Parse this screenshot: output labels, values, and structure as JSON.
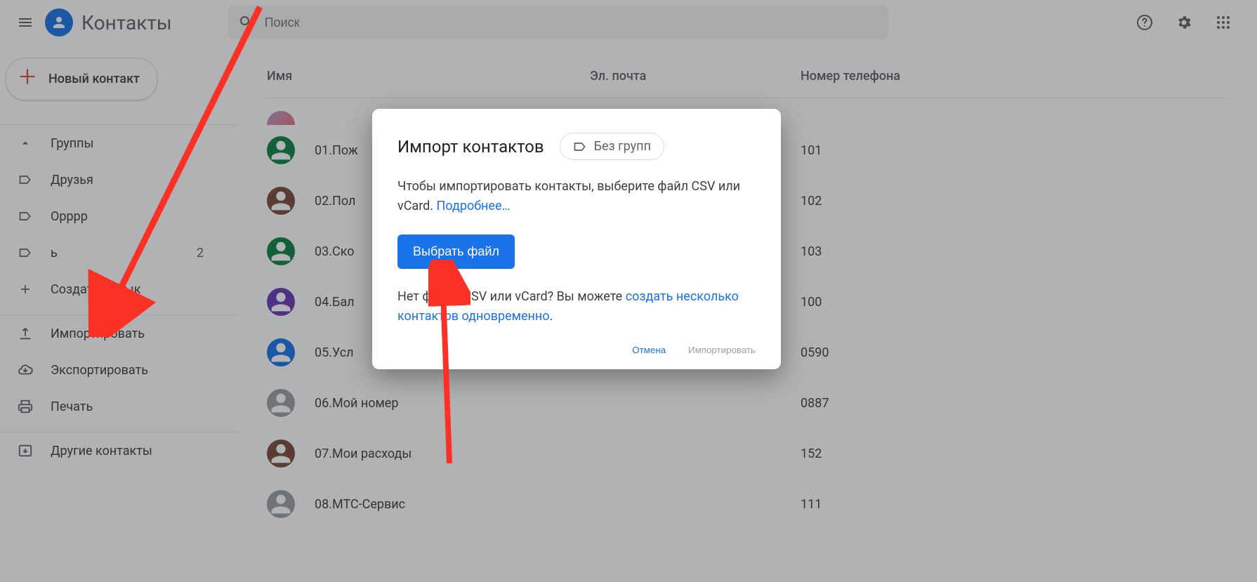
{
  "header": {
    "app_title": "Контакты",
    "search_placeholder": "Поиск"
  },
  "sidebar": {
    "new_contact_label": "Новый контакт",
    "groups_label": "Группы",
    "labels": [
      {
        "name": "Друзья"
      },
      {
        "name": "Opppp"
      },
      {
        "name": "ь",
        "count": "2"
      }
    ],
    "create_label": "Создать ярлык",
    "import_label": "Импортировать",
    "export_label": "Экспортировать",
    "print_label": "Печать",
    "other_contacts_label": "Другие контакты"
  },
  "table": {
    "col_name": "Имя",
    "col_email": "Эл. почта",
    "col_phone": "Номер телефона"
  },
  "contacts": [
    {
      "name": "01.Пож",
      "phone": "101",
      "color": "#0b8043"
    },
    {
      "name": "02.Пол",
      "phone": "102",
      "color": "#7b4b3a"
    },
    {
      "name": "03.Ско",
      "phone": "103",
      "color": "#0b8043"
    },
    {
      "name": "04.Бал",
      "phone": "100",
      "color": "#673ab7"
    },
    {
      "name": "05.Усл",
      "phone": "0590",
      "color": "#1a73e8"
    },
    {
      "name": "06.Мой номер",
      "phone": "0887",
      "color": "#9aa0a6"
    },
    {
      "name": "07.Мои расходы",
      "phone": "152",
      "color": "#7b4b3a"
    },
    {
      "name": "08.МТС-Сервис",
      "phone": "111",
      "color": "#9aa0a6"
    }
  ],
  "modal": {
    "title": "Импорт контактов",
    "chip_label": "Без групп",
    "body_text1": "Чтобы импортировать контакты, выберите файл CSV или vCard. ",
    "learn_more": "Подробнее…",
    "pick_file_label": "Выбрать файл",
    "body_text2a": "Нет файла CSV или vCard? Вы можете ",
    "body_text2_link": "создать несколько контактов одновременно",
    "body_text2_end": ".",
    "cancel_label": "Отмена",
    "import_label": "Импортировать"
  }
}
